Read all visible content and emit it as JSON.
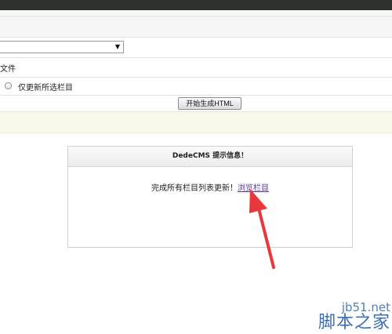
{
  "form": {
    "select_value": "",
    "file_label_fragment": "文件",
    "radio_label": "仅更新所选栏目",
    "generate_button": "开始生成HTML"
  },
  "message": {
    "title": "DedeCMS 提示信息！",
    "text": "完成所有栏目列表更新！",
    "link_label": "浏览栏目"
  },
  "annotation": {
    "arrow_color": "#e8383a"
  },
  "watermark": {
    "line1": "jb51.net",
    "line2": "脚本之家"
  },
  "colors": {
    "topbar": "#2e322d",
    "notice_row": "#f9f9ea",
    "link": "#5a2fa0"
  }
}
